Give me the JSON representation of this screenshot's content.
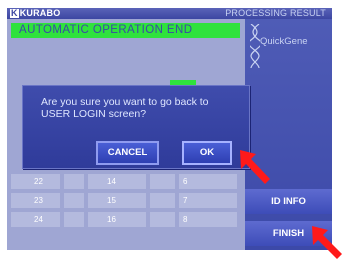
{
  "header": {
    "logo_k": "K",
    "logo_text": "KURABO",
    "title": "PROCESSING RESULT"
  },
  "status_banner": "AUTOMATIC OPERATION END",
  "brand": "QuickGene",
  "dialog": {
    "line1": "Are you sure you want to go back to",
    "line2": "USER LOGIN screen?",
    "cancel_label": "CANCEL",
    "ok_label": "OK"
  },
  "slots": [
    {
      "number": "22"
    },
    {
      "number": "14"
    },
    {
      "number": "6"
    },
    {
      "number": "23"
    },
    {
      "number": "15"
    },
    {
      "number": "7"
    },
    {
      "number": "24"
    },
    {
      "number": "16"
    },
    {
      "number": "8"
    }
  ],
  "side_buttons": {
    "id_info": "ID INFO",
    "finish": "FINISH"
  },
  "colors": {
    "background": "#9fa6d3",
    "status_green": "#2fe23d",
    "annotation_arrow": "#ff1a1a"
  }
}
